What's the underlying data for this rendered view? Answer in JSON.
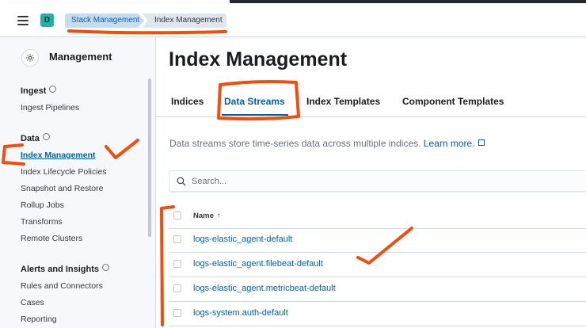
{
  "header": {
    "space_initial": "D",
    "breadcrumbs": [
      "Stack Management",
      "Index Management"
    ]
  },
  "sidebar": {
    "title": "Management",
    "groups": [
      {
        "label": "Ingest",
        "items": [
          "Ingest Pipelines"
        ]
      },
      {
        "label": "Data",
        "items": [
          "Index Management",
          "Index Lifecycle Policies",
          "Snapshot and Restore",
          "Rollup Jobs",
          "Transforms",
          "Remote Clusters"
        ]
      },
      {
        "label": "Alerts and Insights",
        "items": [
          "Rules and Connectors",
          "Cases",
          "Reporting"
        ]
      }
    ],
    "active_item": "Index Management"
  },
  "main": {
    "title": "Index Management",
    "tabs": [
      "Indices",
      "Data Streams",
      "Index Templates",
      "Component Templates"
    ],
    "selected_tab": "Data Streams",
    "description": "Data streams store time-series data across multiple indices.",
    "learn_more": "Learn more.",
    "search_placeholder": "Search...",
    "table": {
      "column_name": "Name",
      "sort_indicator": "↑",
      "rows": [
        "logs-elastic_agent-default",
        "logs-elastic_agent.filebeat-default",
        "logs-elastic_agent.metricbeat-default",
        "logs-system.auth-default"
      ]
    }
  },
  "colors": {
    "accent": "#0061a6",
    "annotation": "#f04e0b",
    "avatar": "#23b1a3"
  },
  "icons": [
    "menu-icon",
    "gear-icon",
    "info-icon",
    "external-link-icon",
    "search-icon",
    "sort-ascending-icon",
    "checkbox-icon"
  ]
}
